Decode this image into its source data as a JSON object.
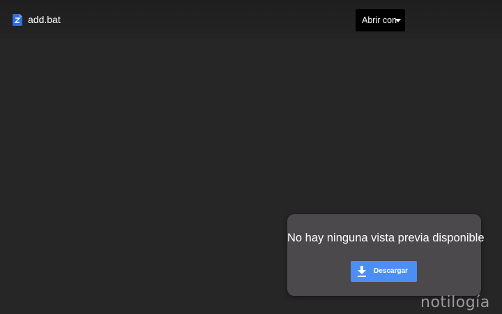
{
  "header": {
    "file_name": "add.bat",
    "file_icon": "bat-file-icon",
    "open_with_label": "Abrir con",
    "open_with_icon": "caret-down-icon"
  },
  "preview": {
    "message": "No hay ninguna vista previa disponible",
    "download_label": "Descargar",
    "download_icon": "download-icon"
  },
  "watermark": {
    "text": "notilogía"
  },
  "colors": {
    "background": "#262626",
    "card": "#4b494c",
    "accent_blue": "#4a8ff3",
    "open_with_bg": "#000000",
    "watermark": "#9a9a9a"
  }
}
